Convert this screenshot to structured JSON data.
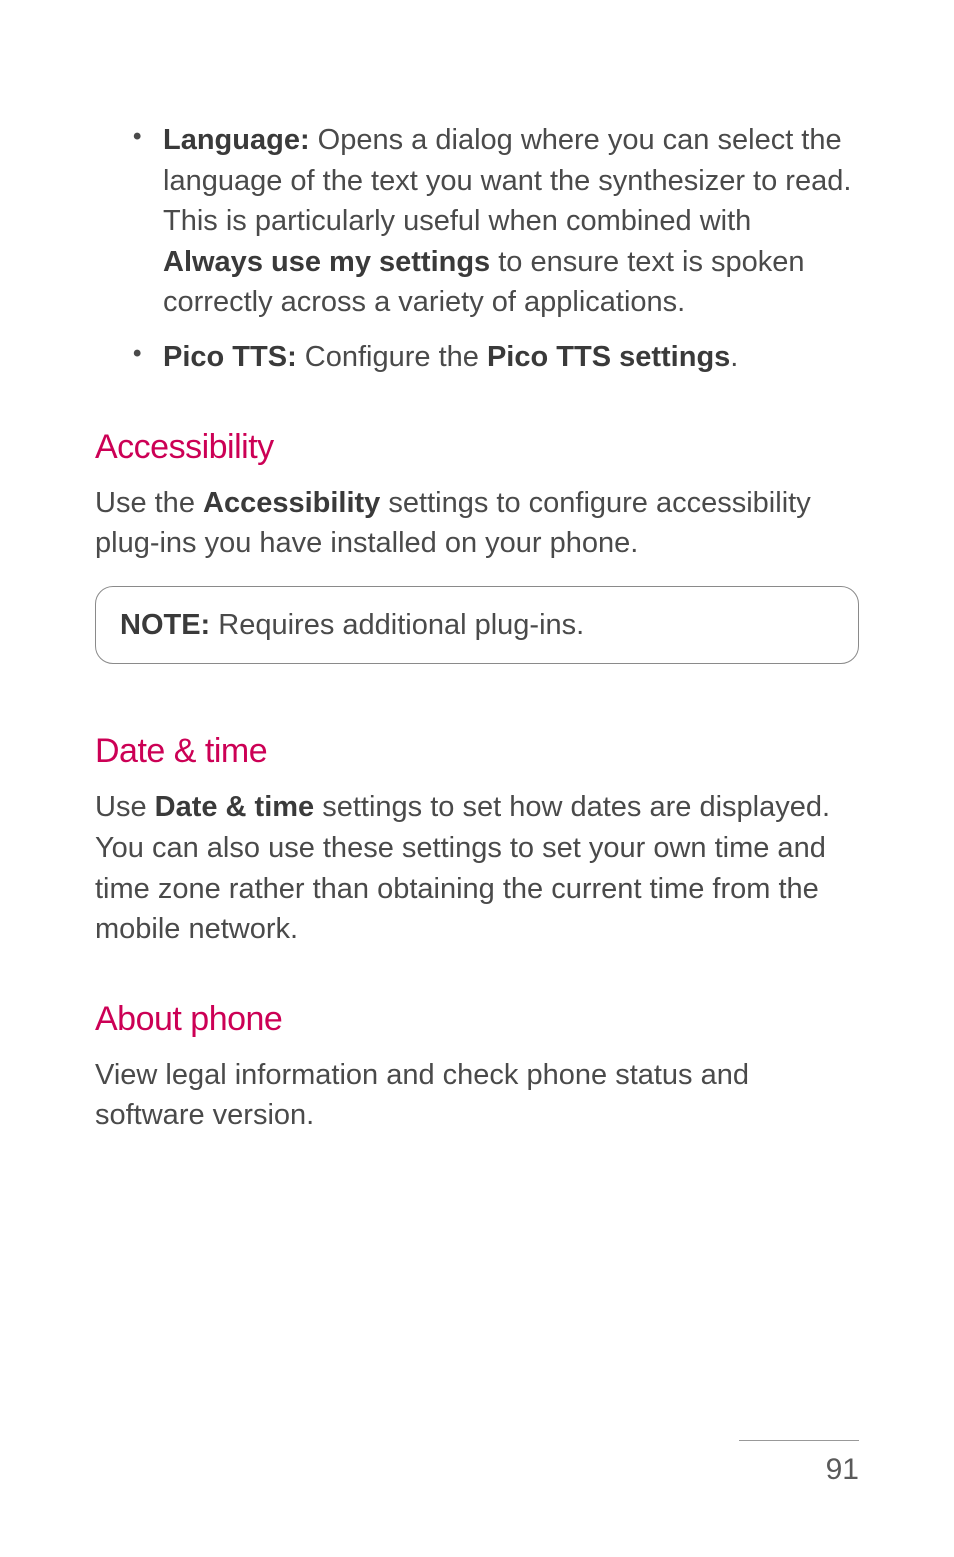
{
  "bullets": [
    {
      "label": "Language:",
      "text_before": " Opens a dialog where you can select the language of the text you want the synthesizer to read. This is particularly useful when combined with ",
      "bold_mid": "Always use my settings",
      "text_after": " to ensure text is spoken correctly across a variety of applications."
    },
    {
      "label": "Pico TTS:",
      "text_before": " Configure the ",
      "bold_mid": "Pico TTS settings",
      "text_after": "."
    }
  ],
  "accessibility": {
    "heading": "Accessibility",
    "para_before": "Use the ",
    "para_bold": "Accessibility",
    "para_after": " settings to configure accessibility plug-ins you have installed on your phone.",
    "note_label": "NOTE:",
    "note_text": " Requires additional plug-ins."
  },
  "datetime": {
    "heading": "Date & time",
    "para_before": "Use ",
    "para_bold": "Date & time",
    "para_after": " settings to set how dates are displayed. You can also use these settings to set your own time and time zone rather than obtaining the current time from the mobile network."
  },
  "aboutphone": {
    "heading": "About phone",
    "para": "View legal information and check phone status and software version."
  },
  "page_number": "91"
}
